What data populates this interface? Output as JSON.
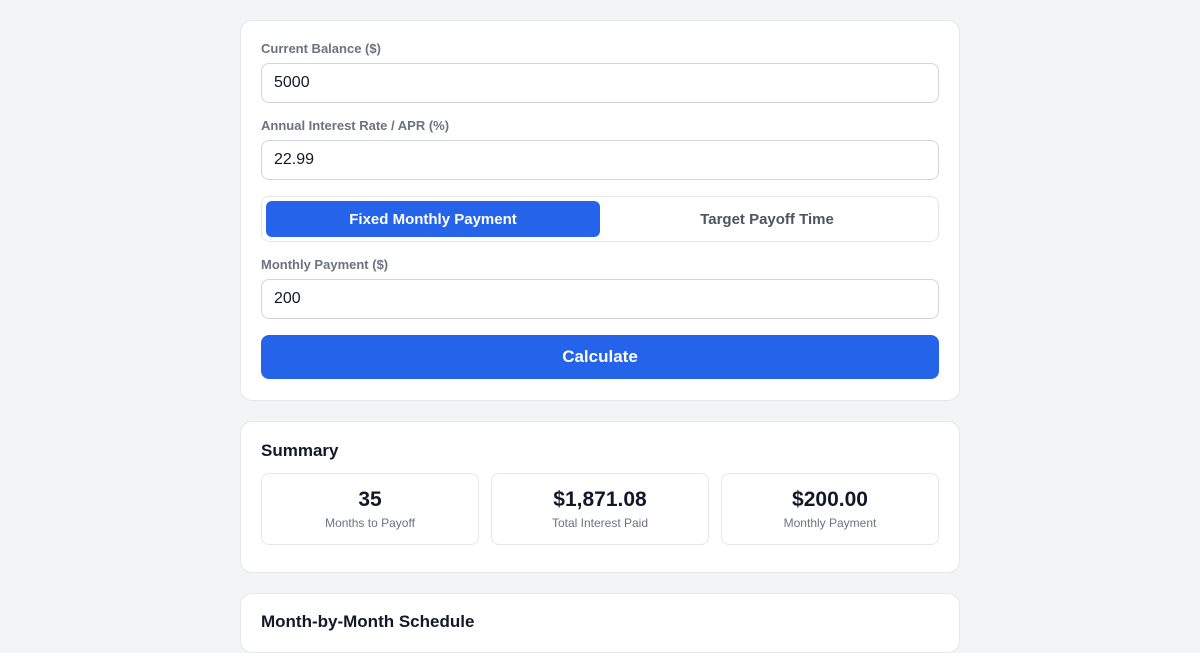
{
  "form": {
    "balance_label": "Current Balance ($)",
    "balance_value": "5000",
    "apr_label": "Annual Interest Rate / APR (%)",
    "apr_value": "22.99",
    "mode_tabs": [
      {
        "label": "Fixed Monthly Payment",
        "active": true
      },
      {
        "label": "Target Payoff Time",
        "active": false
      }
    ],
    "payment_label": "Monthly Payment ($)",
    "payment_value": "200",
    "calculate_label": "Calculate"
  },
  "summary": {
    "title": "Summary",
    "stats": [
      {
        "value": "35",
        "label": "Months to Payoff"
      },
      {
        "value": "$1,871.08",
        "label": "Total Interest Paid"
      },
      {
        "value": "$200.00",
        "label": "Monthly Payment"
      }
    ]
  },
  "schedule": {
    "title": "Month-by-Month Schedule"
  },
  "colors": {
    "accent": "#2563eb",
    "background": "#f3f4f6",
    "card": "#ffffff",
    "muted_text": "#6b7280"
  }
}
